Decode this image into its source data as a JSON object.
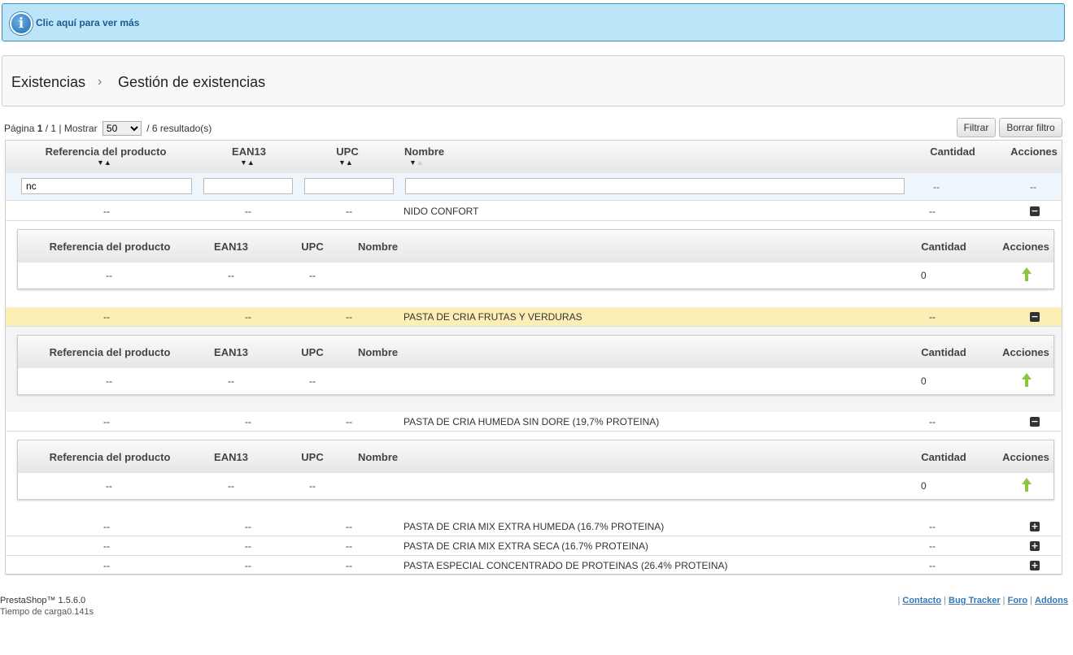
{
  "info": {
    "text": "Clic aquí para ver más",
    "icon": "info-icon"
  },
  "breadcrumb": {
    "parent": "Existencias",
    "current": "Gestión de existencias"
  },
  "pagination": {
    "page_label": "Página",
    "page": "1",
    "total_pages": "/ 1 |",
    "show_label": "Mostrar",
    "per_page": "50",
    "results": "/ 6 resultado(s)"
  },
  "buttons": {
    "filter": "Filtrar",
    "reset": "Borrar filtro"
  },
  "columns": {
    "ref": "Referencia del producto",
    "ean": "EAN13",
    "upc": "UPC",
    "name": "Nombre",
    "qty": "Cantidad",
    "actions": "Acciones"
  },
  "filters": {
    "ref": "nc",
    "ean": "",
    "upc": "",
    "name": "",
    "qty": "--",
    "actions": "--"
  },
  "rows": [
    {
      "ref": "--",
      "ean": "--",
      "upc": "--",
      "name": "NIDO CONFORT",
      "qty": "--",
      "toggle": "−",
      "expanded": true,
      "sub": {
        "ref": "--",
        "ean": "--",
        "upc": "--",
        "name": "",
        "qty": "0"
      }
    },
    {
      "ref": "--",
      "ean": "--",
      "upc": "--",
      "name": "PASTA DE CRIA FRUTAS Y VERDURAS",
      "qty": "--",
      "toggle": "−",
      "expanded": true,
      "highlight": true,
      "sub": {
        "ref": "--",
        "ean": "--",
        "upc": "--",
        "name": "",
        "qty": "0"
      }
    },
    {
      "ref": "--",
      "ean": "--",
      "upc": "--",
      "name": "PASTA DE CRIA HUMEDA SIN DORE (19,7% PROTEINA)",
      "qty": "--",
      "toggle": "−",
      "expanded": true,
      "sub": {
        "ref": "--",
        "ean": "--",
        "upc": "--",
        "name": "",
        "qty": "0"
      }
    },
    {
      "ref": "--",
      "ean": "--",
      "upc": "--",
      "name": "PASTA DE CRIA MIX EXTRA HUMEDA (16.7% PROTEINA)",
      "qty": "--",
      "toggle": "+",
      "expanded": false
    },
    {
      "ref": "--",
      "ean": "--",
      "upc": "--",
      "name": "PASTA DE CRIA MIX EXTRA SECA (16.7% PROTEINA)",
      "qty": "--",
      "toggle": "+",
      "expanded": false
    },
    {
      "ref": "--",
      "ean": "--",
      "upc": "--",
      "name": "PASTA ESPECIAL CONCENTRADO DE PROTEINAS (26.4% PROTEINA)",
      "qty": "--",
      "toggle": "+",
      "expanded": false
    }
  ],
  "footer": {
    "version": "PrestaShop™ 1.5.6.0",
    "load_time": "Tiempo de carga0.141s",
    "links": [
      "Contacto",
      "Bug Tracker",
      "Foro",
      "Addons"
    ]
  },
  "colors": {
    "info_bg": "#bde5f8",
    "highlight": "#fdeeb5",
    "arrow": "#8cc63f"
  }
}
